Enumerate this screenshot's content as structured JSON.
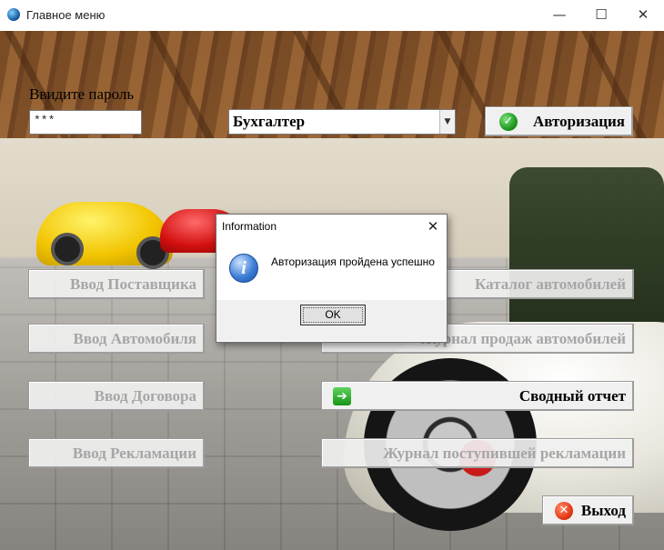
{
  "window": {
    "title": "Главное меню",
    "controls": {
      "minimize": "—",
      "maximize": "☐",
      "close": "✕"
    }
  },
  "login": {
    "password_label": "Ввидите пароль",
    "password_value": "***",
    "role_value": "Бухгалтер",
    "auth_button_label": "Авторизация"
  },
  "menu": {
    "left": [
      {
        "label": "Ввод Поставщика",
        "enabled": false
      },
      {
        "label": "Ввод Автомобиля",
        "enabled": false
      },
      {
        "label": "Ввод Договора",
        "enabled": false
      },
      {
        "label": "Ввод Рекламации",
        "enabled": false
      }
    ],
    "right": [
      {
        "label": "Каталог автомобилей",
        "enabled": false
      },
      {
        "label": "Журнал продаж автомобилей",
        "enabled": false
      },
      {
        "label": "Сводный отчет",
        "enabled": true
      },
      {
        "label": "Журнал поступившей рекламации",
        "enabled": false
      }
    ],
    "exit_label": "Выход"
  },
  "dialog": {
    "title": "Information",
    "message": "Авторизация пройдена успешно",
    "ok_label": "OK"
  },
  "icons": {
    "app": "globe-icon",
    "auth": "check-icon",
    "report": "arrow-right-icon",
    "exit": "close-circle-icon",
    "dialog": "info-icon"
  },
  "colors": {
    "disabled_text": "#a6a6a6",
    "auth_check": "#1f9a1f",
    "exit_red": "#e43b1a",
    "info_blue": "#3e7fd6"
  }
}
